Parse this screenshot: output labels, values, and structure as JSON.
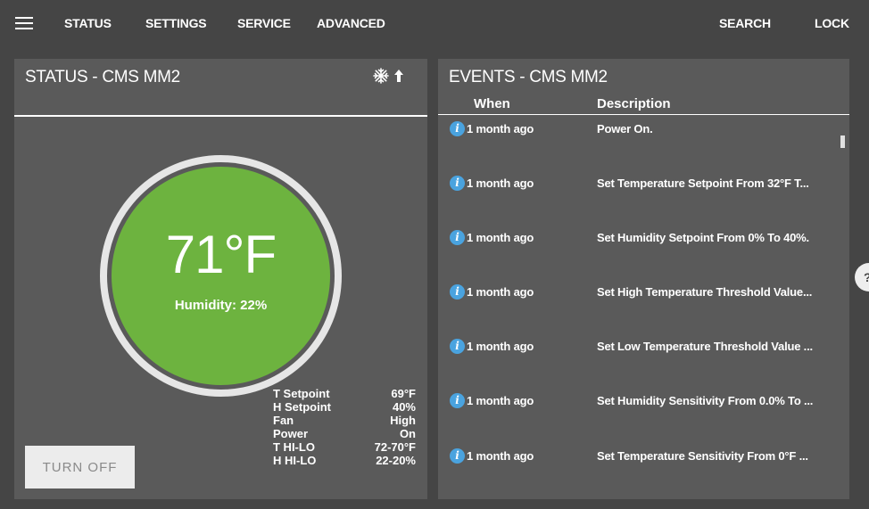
{
  "nav": {
    "status": "STATUS",
    "settings": "SETTINGS",
    "service": "SERVICE",
    "advanced": "ADVANCED",
    "search": "SEARCH",
    "lock": "LOCK"
  },
  "status_panel": {
    "title": "STATUS - CMS MM2",
    "temperature": "71°F",
    "humidity": "Humidity: 22%",
    "dial_color": "#6db33f",
    "icons": [
      "snowflake-icon",
      "up-arrow-icon"
    ],
    "stats": [
      {
        "label": "T Setpoint",
        "value": "69°F"
      },
      {
        "label": "H Setpoint",
        "value": "40%"
      },
      {
        "label": "Fan",
        "value": "High"
      },
      {
        "label": "Power",
        "value": "On"
      },
      {
        "label": "T HI-LO",
        "value": "72-70°F"
      },
      {
        "label": "H HI-LO",
        "value": "22-20%"
      }
    ],
    "turn_off_label": "TURN OFF"
  },
  "events_panel": {
    "title": "EVENTS - CMS MM2",
    "col_when": "When",
    "col_description": "Description",
    "info_icon_color": "#4aa3df",
    "info_glyph": "i",
    "events": [
      {
        "when": "1 month ago",
        "description": "Power On."
      },
      {
        "when": "1 month ago",
        "description": "Set Temperature Setpoint From 32°F T..."
      },
      {
        "when": "1 month ago",
        "description": "Set Humidity Setpoint From 0% To 40%."
      },
      {
        "when": "1 month ago",
        "description": "Set High Temperature Threshold Value..."
      },
      {
        "when": "1 month ago",
        "description": "Set Low Temperature Threshold Value ..."
      },
      {
        "when": "1 month ago",
        "description": "Set Humidity Sensitivity From 0.0% To ..."
      },
      {
        "when": "1 month ago",
        "description": "Set Temperature Sensitivity From 0°F ..."
      }
    ]
  },
  "help": {
    "label": "?"
  }
}
